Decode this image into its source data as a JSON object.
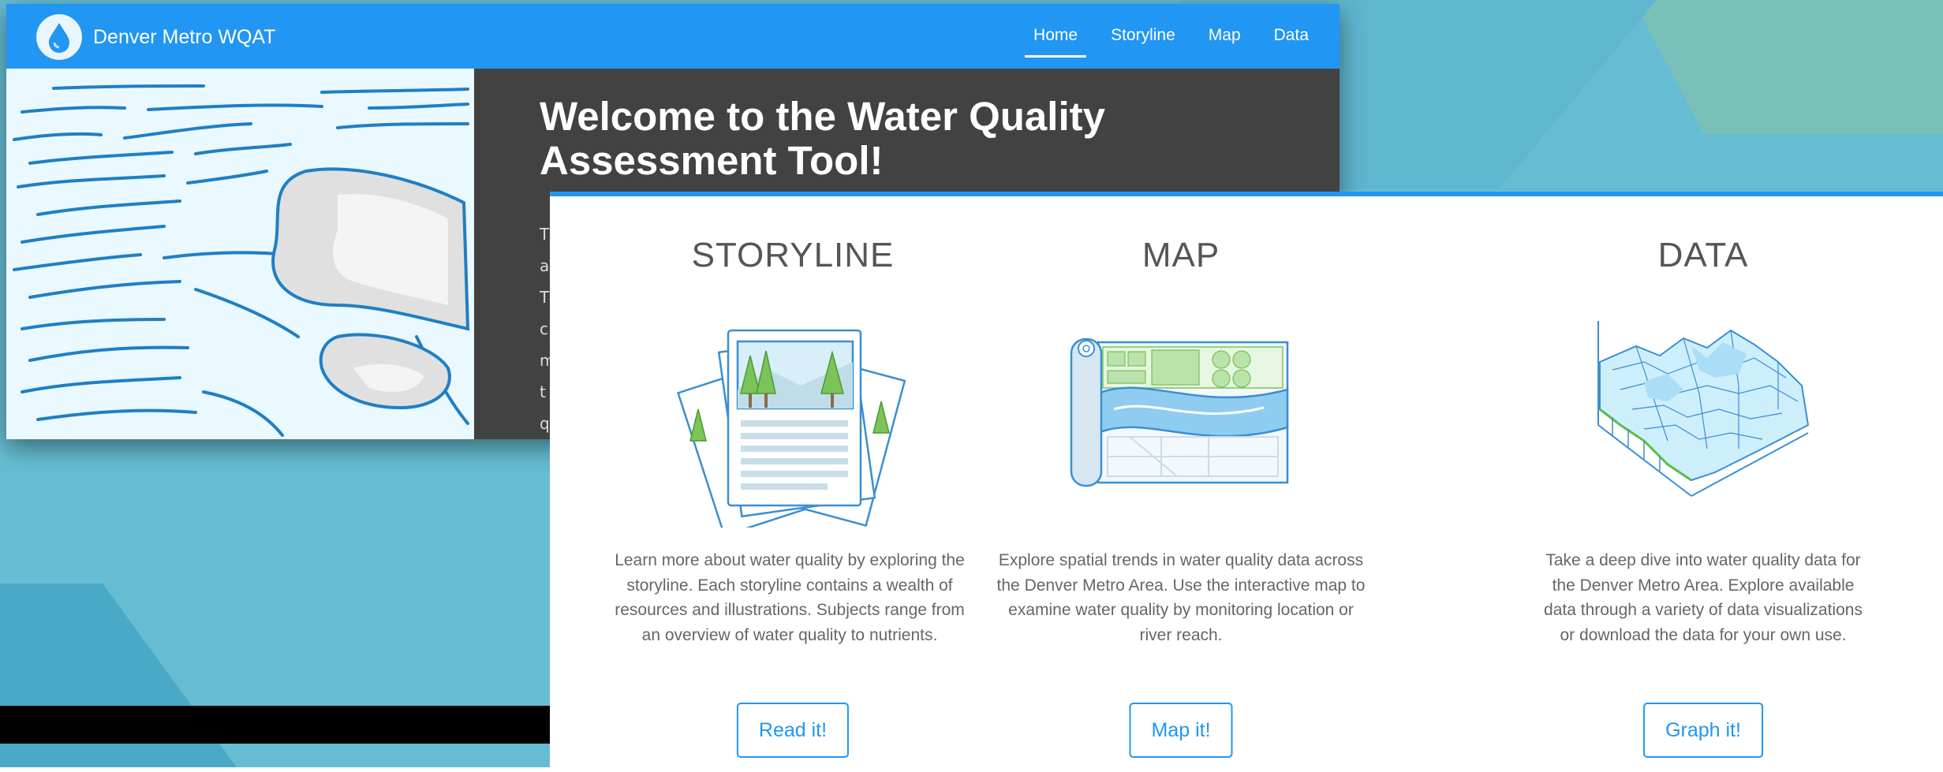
{
  "navbar": {
    "brand": "Denver Metro WQAT",
    "links": [
      {
        "label": "Home",
        "active": true
      },
      {
        "label": "Storyline",
        "active": false
      },
      {
        "label": "Map",
        "active": false
      },
      {
        "label": "Data",
        "active": false
      }
    ]
  },
  "hero": {
    "title": "Welcome to the Water Quality Assessment Tool!",
    "body_fragment": "T a T c m t q"
  },
  "sections": [
    {
      "title": "STORYLINE",
      "icon": "newspaper-icon",
      "description": "Learn more about water quality by exploring the storyline. Each storyline contains a wealth of resources and illustrations. Subjects range from an overview of water quality to nutrients.",
      "button": "Read it!"
    },
    {
      "title": "MAP",
      "icon": "map-scroll-icon",
      "description": "Explore spatial trends in water quality data across the Denver Metro Area. Use the interactive map to examine water quality by monitoring location or river reach.",
      "button": "Map it!"
    },
    {
      "title": "DATA",
      "icon": "3d-surface-chart-icon",
      "description": "Take a deep dive into water quality data for the Denver Metro Area. Explore available data through a variety of data visualizations or download the data for your own use.",
      "button": "Graph it!"
    }
  ],
  "colors": {
    "primary": "#2196f3",
    "dark_panel": "#424242",
    "background": "#67bdd3"
  }
}
